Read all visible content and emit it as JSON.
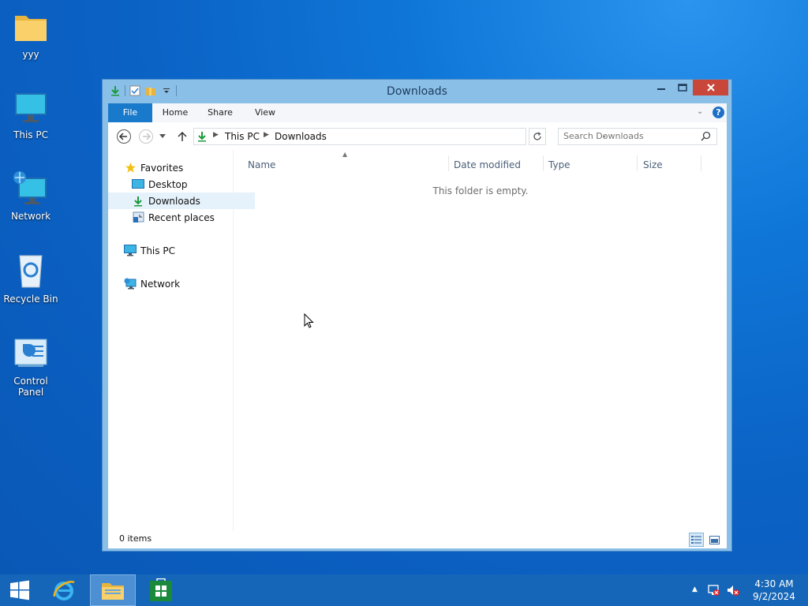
{
  "desktop": {
    "icons": [
      {
        "label": "yyy",
        "icon": "folder-icon"
      },
      {
        "label": "This PC",
        "icon": "monitor-icon"
      },
      {
        "label": "Network",
        "icon": "network-icon"
      },
      {
        "label": "Recycle Bin",
        "icon": "recycle-bin-icon"
      },
      {
        "label": "Control Panel",
        "icon": "control-panel-icon"
      }
    ]
  },
  "window": {
    "title": "Downloads",
    "ribbon_tabs": [
      "File",
      "Home",
      "Share",
      "View"
    ],
    "address": {
      "crumbs": [
        "This PC",
        "Downloads"
      ]
    },
    "search": {
      "placeholder": "Search Downloads"
    },
    "nav_pane": {
      "favorites_label": "Favorites",
      "favorites_items": [
        "Desktop",
        "Downloads",
        "Recent places"
      ],
      "this_pc_label": "This PC",
      "network_label": "Network",
      "selected": "Downloads"
    },
    "columns": [
      "Name",
      "Date modified",
      "Type",
      "Size"
    ],
    "empty_message": "This folder is empty.",
    "status": "0 items"
  },
  "taskbar": {
    "clock": {
      "time": "4:30 AM",
      "date": "9/2/2024"
    }
  },
  "colors": {
    "desktop_bg": "#0b63c6",
    "window_frame": "#8ac0e8",
    "file_tab": "#1979ca",
    "taskbar": "#1566b8",
    "close_button": "#c8463a"
  }
}
